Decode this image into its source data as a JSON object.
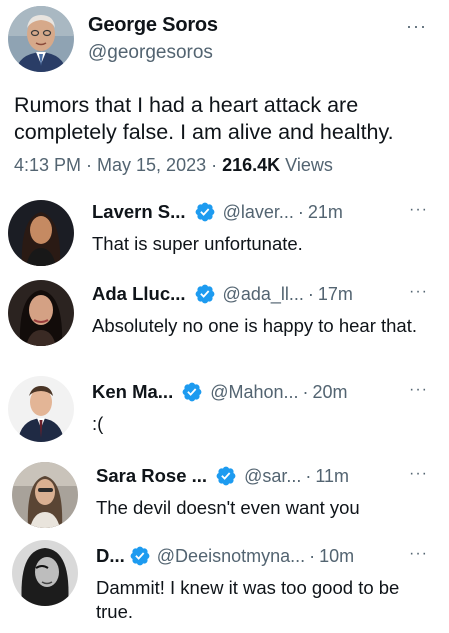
{
  "main": {
    "name": "George Soros",
    "handle": "@georgesoros",
    "more": "···",
    "text": "Rumors that I had a heart attack are completely false. I am alive and healthy.",
    "time": "4:13 PM · May 15, 2023 · ",
    "views_count": "216.4K",
    "views_label": " Views",
    "avatar_icon": "person-avatar-icon"
  },
  "colors": {
    "verified": "#1d9bf0",
    "secondary_text": "#536471",
    "primary_text": "#0f1419"
  },
  "replies": [
    {
      "name": "Lavern S...",
      "handle": "@laver...",
      "time": "21m",
      "text": "That is super unfortunate.",
      "verified": true,
      "more": "···"
    },
    {
      "name": "Ada Lluc...",
      "handle": "@ada_ll...",
      "time": "17m",
      "text": "Absolutely no one is happy to hear that.",
      "verified": true,
      "more": "···"
    },
    {
      "name": "Ken Ma...",
      "handle": "@Mahon...",
      "time": "20m",
      "text": ":(",
      "verified": true,
      "more": "···"
    },
    {
      "name": "Sara Rose ...",
      "handle": "@sar...",
      "time": "11m",
      "text": "The devil doesn't even want you",
      "verified": true,
      "more": "···"
    },
    {
      "name": "D...",
      "handle": "@Deeisnotmyna...",
      "time": "10m",
      "text": "Dammit! I knew it was too good to be true.",
      "verified": true,
      "more": "···"
    }
  ]
}
